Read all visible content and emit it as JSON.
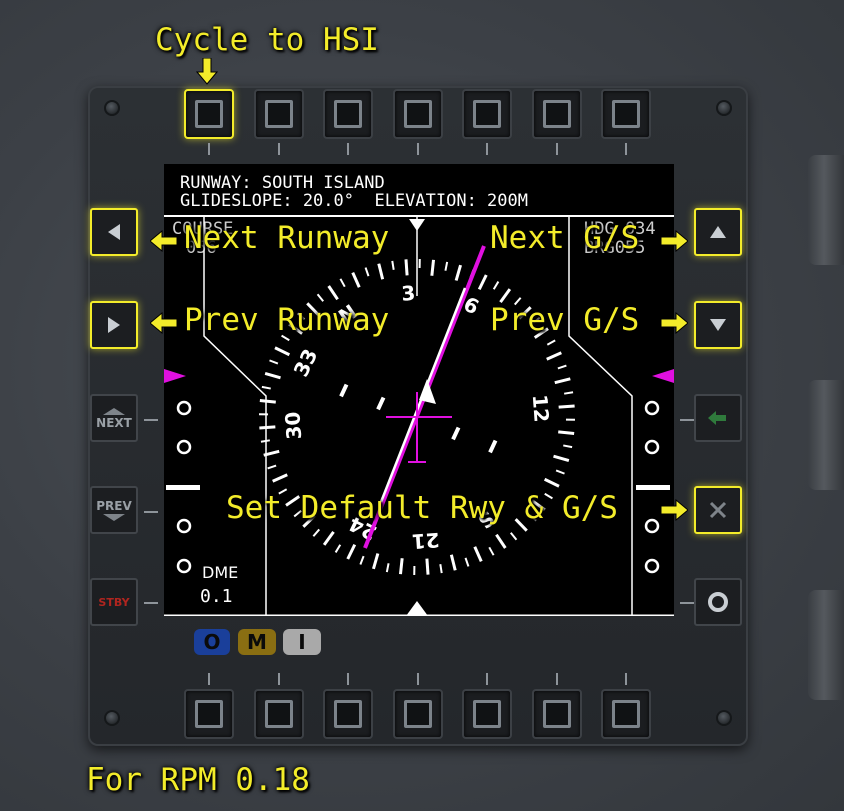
{
  "labels": {
    "cycle_hsi": "Cycle to HSI",
    "next_runway": "Next Runway",
    "prev_runway": "Prev Runway",
    "next_gs": "Next G/S",
    "prev_gs": "Prev G/S",
    "set_default": "Set Default Rwy & G/S",
    "footer": "For RPM 0.18"
  },
  "screen": {
    "runway_line": "RUNWAY: SOUTH ISLAND",
    "glideslope_line": "GLIDESLOPE: 20.0°  ELEVATION: 200M",
    "course_label": "COURSE",
    "course_value": "056",
    "hdg_label": "HDG 034",
    "brg_label": "BRG055",
    "dme_label": "DME",
    "dme_value": "0.1",
    "compass_labels": [
      "N",
      "3",
      "6",
      "E",
      "12",
      "S",
      "21",
      "24",
      "W",
      "30",
      "33"
    ]
  },
  "side_buttons": {
    "next_label": "NEXT",
    "prev_label": "PREV",
    "stby_label": "STBY"
  },
  "marker_beacons": {
    "o": "O",
    "m": "M",
    "i": "I"
  },
  "colors": {
    "accent": "#f3ec2a",
    "magenta": "#e010e0",
    "outer": "#1a3f9a",
    "middle": "#8a6e12",
    "inner": "#a9a9a9"
  }
}
